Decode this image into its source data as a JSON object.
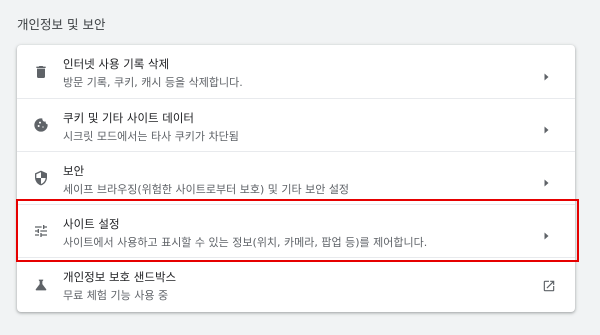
{
  "section": {
    "title": "개인정보 및 보안"
  },
  "rows": [
    {
      "icon": "trash-icon",
      "label": "인터넷 사용 기록 삭제",
      "sub": "방문 기록, 쿠키, 캐시 등을 삭제합니다.",
      "action": "chevron-right-icon"
    },
    {
      "icon": "cookie-icon",
      "label": "쿠키 및 기타 사이트 데이터",
      "sub": "시크릿 모드에서는 타사 쿠키가 차단됨",
      "action": "chevron-right-icon"
    },
    {
      "icon": "shield-icon",
      "label": "보안",
      "sub": "세이프 브라우징(위험한 사이트로부터 보호) 및 기타 보안 설정",
      "action": "chevron-right-icon"
    },
    {
      "icon": "tune-sliders-icon",
      "label": "사이트 설정",
      "sub": "사이트에서 사용하고 표시할 수 있는 정보(위치, 카메라, 팝업 등)를 제어합니다.",
      "action": "chevron-right-icon"
    },
    {
      "icon": "flask-icon",
      "label": "개인정보 보호 샌드박스",
      "sub": "무료 체험 기능 사용 중",
      "action": "open-external-icon"
    }
  ],
  "highlight_color": "#e60000"
}
